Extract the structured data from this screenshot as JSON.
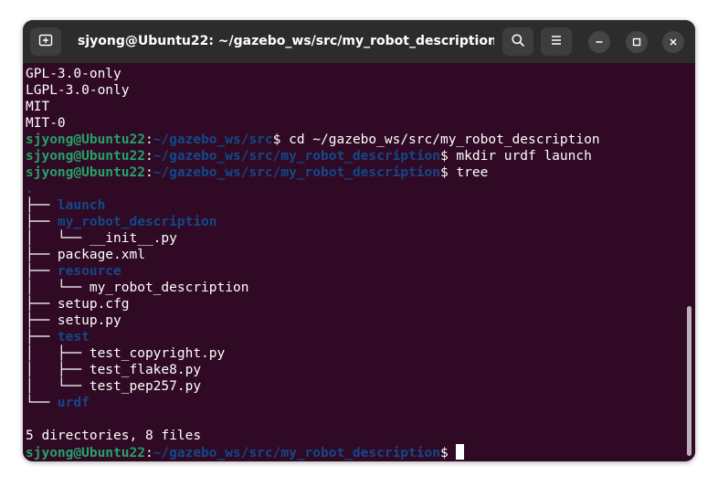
{
  "window": {
    "title": "sjyong@Ubuntu22: ~/gazebo_ws/src/my_robot_description",
    "icons": {
      "new_tab": "new-tab-icon",
      "search": "search-icon",
      "menu": "hamburger-menu-icon",
      "minimize": "minimize-icon",
      "maximize": "maximize-icon",
      "close": "close-icon"
    }
  },
  "colors": {
    "background": "#300a24",
    "user_host": "#26a269",
    "path": "#12488b",
    "directory": "#12488b",
    "text": "#ffffff",
    "titlebar": "#2c2c2c"
  },
  "terminal": {
    "lines": [
      [
        {
          "t": "GPL-3.0-only",
          "c": "w"
        }
      ],
      [
        {
          "t": "LGPL-3.0-only",
          "c": "w"
        }
      ],
      [
        {
          "t": "MIT",
          "c": "w"
        }
      ],
      [
        {
          "t": "MIT-0",
          "c": "w"
        }
      ],
      [
        {
          "t": "sjyong@Ubuntu22",
          "c": "u"
        },
        {
          "t": ":",
          "c": "w"
        },
        {
          "t": "~/gazebo_ws/src",
          "c": "p"
        },
        {
          "t": "$ cd ~/gazebo_ws/src/my_robot_description",
          "c": "w"
        }
      ],
      [
        {
          "t": "sjyong@Ubuntu22",
          "c": "u"
        },
        {
          "t": ":",
          "c": "w"
        },
        {
          "t": "~/gazebo_ws/src/my_robot_description",
          "c": "p"
        },
        {
          "t": "$ mkdir urdf launch",
          "c": "w"
        }
      ],
      [
        {
          "t": "sjyong@Ubuntu22",
          "c": "u"
        },
        {
          "t": ":",
          "c": "w"
        },
        {
          "t": "~/gazebo_ws/src/my_robot_description",
          "c": "p"
        },
        {
          "t": "$ tree",
          "c": "w"
        }
      ],
      [
        {
          "t": ".",
          "c": "d"
        }
      ],
      [
        {
          "t": "├── ",
          "c": "w"
        },
        {
          "t": "launch",
          "c": "d"
        }
      ],
      [
        {
          "t": "├── ",
          "c": "w"
        },
        {
          "t": "my_robot_description",
          "c": "d"
        }
      ],
      [
        {
          "t": "│   └── __init__.py",
          "c": "w"
        }
      ],
      [
        {
          "t": "├── package.xml",
          "c": "w"
        }
      ],
      [
        {
          "t": "├── ",
          "c": "w"
        },
        {
          "t": "resource",
          "c": "d"
        }
      ],
      [
        {
          "t": "│   └── my_robot_description",
          "c": "w"
        }
      ],
      [
        {
          "t": "├── setup.cfg",
          "c": "w"
        }
      ],
      [
        {
          "t": "├── setup.py",
          "c": "w"
        }
      ],
      [
        {
          "t": "├── ",
          "c": "w"
        },
        {
          "t": "test",
          "c": "d"
        }
      ],
      [
        {
          "t": "│   ├── test_copyright.py",
          "c": "w"
        }
      ],
      [
        {
          "t": "│   ├── test_flake8.py",
          "c": "w"
        }
      ],
      [
        {
          "t": "│   └── test_pep257.py",
          "c": "w"
        }
      ],
      [
        {
          "t": "└── ",
          "c": "w"
        },
        {
          "t": "urdf",
          "c": "d"
        }
      ],
      [
        {
          "t": "",
          "c": "w"
        }
      ],
      [
        {
          "t": "5 directories, 8 files",
          "c": "w"
        }
      ],
      [
        {
          "t": "sjyong@Ubuntu22",
          "c": "u"
        },
        {
          "t": ":",
          "c": "w"
        },
        {
          "t": "~/gazebo_ws/src/my_robot_description",
          "c": "p"
        },
        {
          "t": "$ ",
          "c": "w"
        }
      ]
    ]
  }
}
